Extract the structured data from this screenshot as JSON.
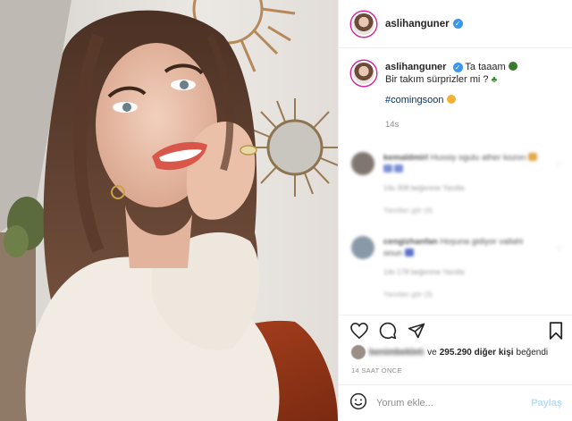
{
  "post": {
    "username": "aslihanguner",
    "caption_line1": "Ta taaam",
    "caption_line2": "Bir takım sürprizler mi ?",
    "hashtag": "#comingsoon",
    "caption_time": "14s",
    "verified_glyph": "✓"
  },
  "comments": [
    {
      "author": "kemaldmirl",
      "text": "Hussiy ogulu ather kozon",
      "meta": "14s  308 beğenme  Yanıtla",
      "replies": "Yanıtları gör (4)"
    },
    {
      "author": "cengizhanfan",
      "text": "Hoşuna gidiyor vallahi onun",
      "meta": "14s  178 beğenme  Yanıtla",
      "replies": "Yanıtları gör (3)"
    }
  ],
  "likes": {
    "blurred_user": "benimbekleti",
    "connector": "ve",
    "count": "295.290 diğer kişi",
    "suffix": "beğendi"
  },
  "timestamp": "14 SAAT ÖNCE",
  "comment_input": {
    "placeholder": "Yorum ekle...",
    "value": ""
  },
  "post_button": "Paylaş",
  "icons": {
    "header_verified": "verified-badge-icon",
    "like": "heart-icon",
    "comment": "comment-icon",
    "share": "send-icon",
    "save": "bookmark-icon",
    "emoji": "smiley-icon"
  },
  "colors": {
    "verified_blue": "#3897f0",
    "hashtag": "#00376b",
    "muted": "#8e8e8e",
    "post_disabled": "#b2dffc",
    "border": "#efefef"
  }
}
